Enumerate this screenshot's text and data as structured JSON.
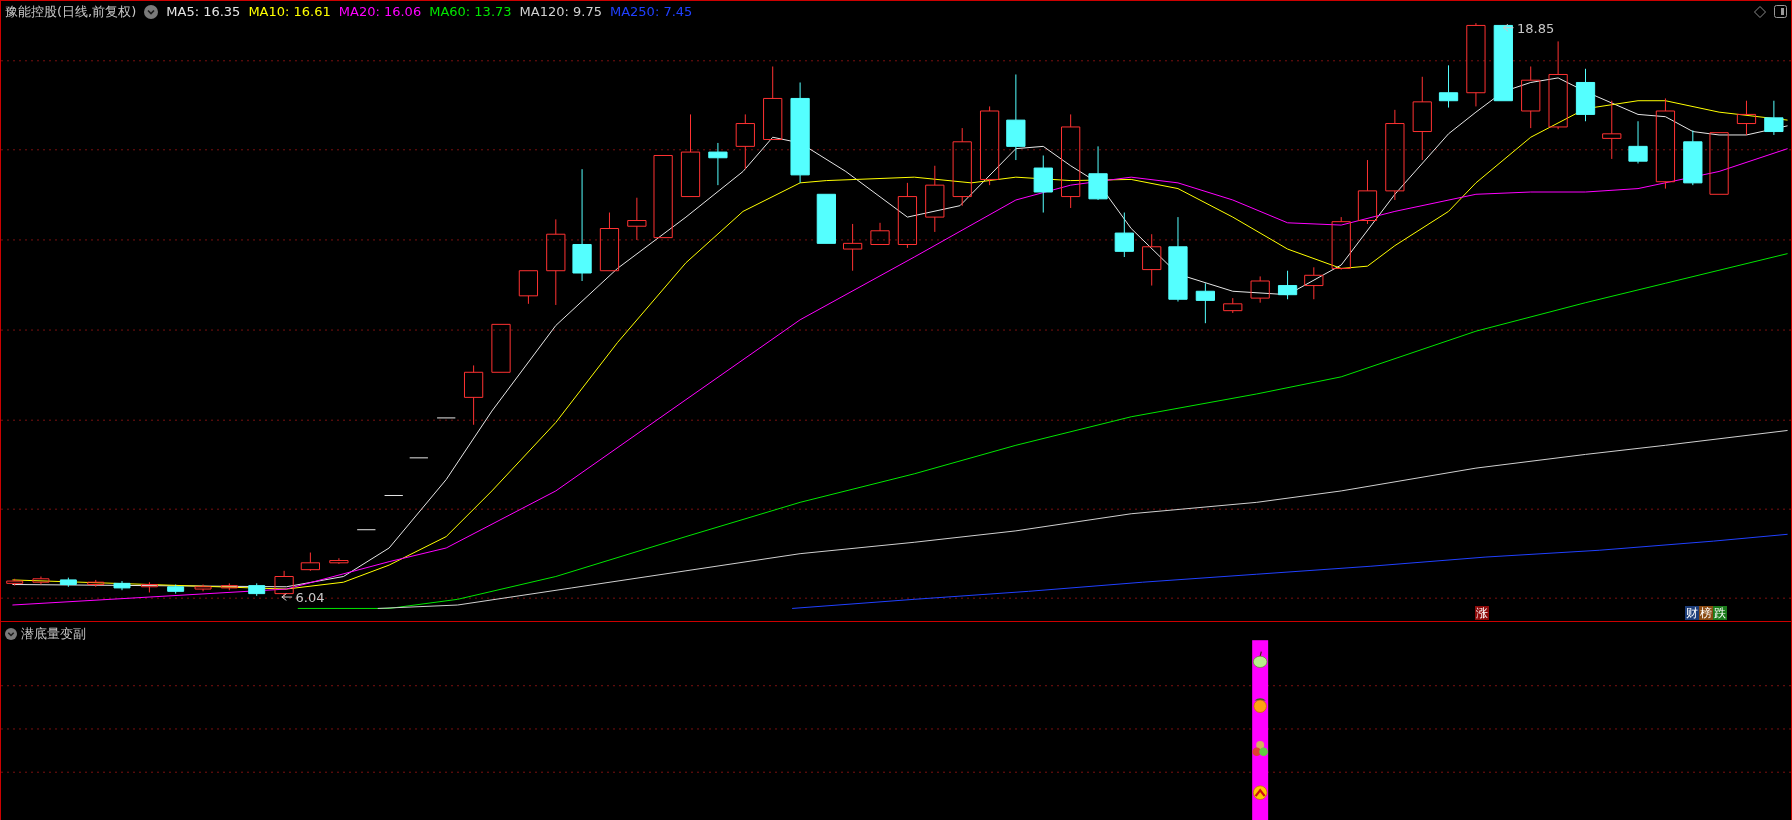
{
  "header": {
    "title": "豫能控股(日线,前复权)",
    "indicators": [
      {
        "label": "MA5: 16.35",
        "color": "#e6e6e6"
      },
      {
        "label": "MA10: 16.61",
        "color": "#ffff00"
      },
      {
        "label": "MA20: 16.06",
        "color": "#ff00ff"
      },
      {
        "label": "MA60: 13.73",
        "color": "#00e600"
      },
      {
        "label": "MA120: 9.75",
        "color": "#d0d0d0"
      },
      {
        "label": "MA250: 7.45",
        "color": "#2040ff"
      }
    ]
  },
  "price_chart": {
    "annotations": [
      {
        "text": "18.85"
      },
      {
        "text": "6.04"
      }
    ],
    "signals": [
      {
        "chars": [
          {
            "text": "涨",
            "color": "#8c0a0a"
          }
        ]
      },
      {
        "chars": [
          {
            "text": "财",
            "color": "#1c3c78"
          },
          {
            "text": "榜",
            "color": "#8a4a12"
          },
          {
            "text": "跌",
            "color": "#1a7a1a"
          }
        ]
      }
    ]
  },
  "indicator_panel": {
    "title": "潜底量变副"
  }
}
